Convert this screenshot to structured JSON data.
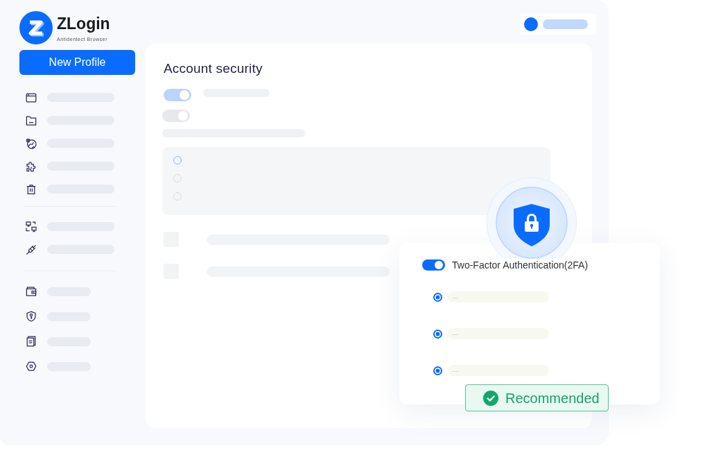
{
  "logo": {
    "name": "ZLogin",
    "tagline": "Antidentect Browser"
  },
  "new_profile_button": {
    "label": "New Profile"
  },
  "account_security": {
    "title": "Account security",
    "toggles": [
      {
        "on": true,
        "disabled": false
      },
      {
        "on": true,
        "disabled": true
      }
    ],
    "radio_options": [
      {
        "selected": false,
        "color": "#8db2f8"
      },
      {
        "selected": false,
        "color": "#d9dadd"
      },
      {
        "selected": false,
        "color": "#d9dadd"
      }
    ]
  },
  "two_factor_card": {
    "toggle": {
      "label": "Two-Factor Authentication(2FA)",
      "on": true
    },
    "options": [
      {
        "text": "…",
        "checked": true
      },
      {
        "text": "…",
        "checked": true
      },
      {
        "text": "…",
        "checked": true
      }
    ],
    "badge": {
      "label": "Recommended"
    }
  }
}
